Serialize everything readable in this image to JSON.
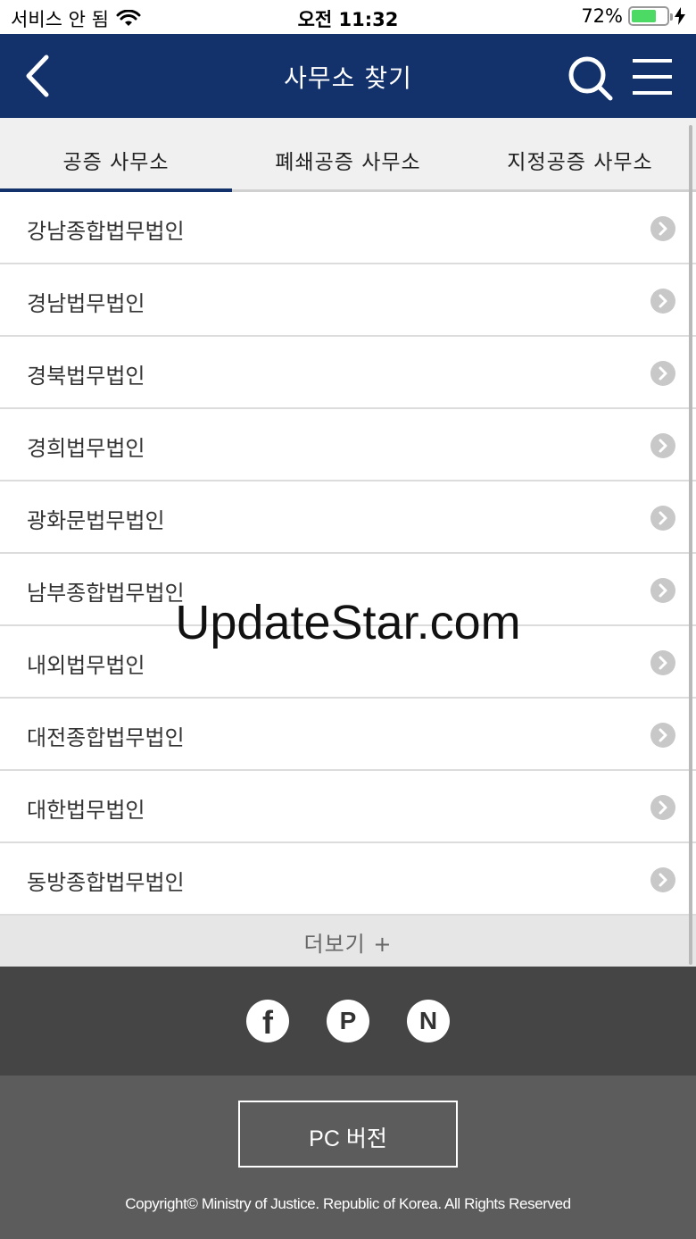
{
  "status_bar": {
    "carrier": "서비스 안 됨",
    "time": "오전 11:32",
    "battery_percent": "72%",
    "battery_level": 0.72,
    "battery_color": "#4cd964"
  },
  "header": {
    "title": "사무소 찾기",
    "background_color": "#13316b",
    "back_icon": "chevron-left-icon",
    "search_icon": "search-icon",
    "menu_icon": "hamburger-menu-icon"
  },
  "tabs": [
    {
      "label": "공증 사무소",
      "active": true
    },
    {
      "label": "폐쇄공증 사무소",
      "active": false
    },
    {
      "label": "지정공증 사무소",
      "active": false
    }
  ],
  "offices": [
    {
      "name": "강남종합법무법인"
    },
    {
      "name": "경남법무법인"
    },
    {
      "name": "경북법무법인"
    },
    {
      "name": "경희법무법인"
    },
    {
      "name": "광화문법무법인"
    },
    {
      "name": "남부종합법무법인"
    },
    {
      "name": "내외법무법인"
    },
    {
      "name": "대전종합법무법인"
    },
    {
      "name": "대한법무법인"
    },
    {
      "name": "동방종합법무법인"
    }
  ],
  "more": {
    "label": "더보기 +"
  },
  "social": {
    "facebook": "f",
    "post": "P",
    "naver": "N"
  },
  "footer": {
    "pc_version_label": "PC 버전",
    "copyright": "Copyright© Ministry of Justice. Republic of Korea. All Rights Reserved"
  },
  "watermark": "UpdateStar.com"
}
